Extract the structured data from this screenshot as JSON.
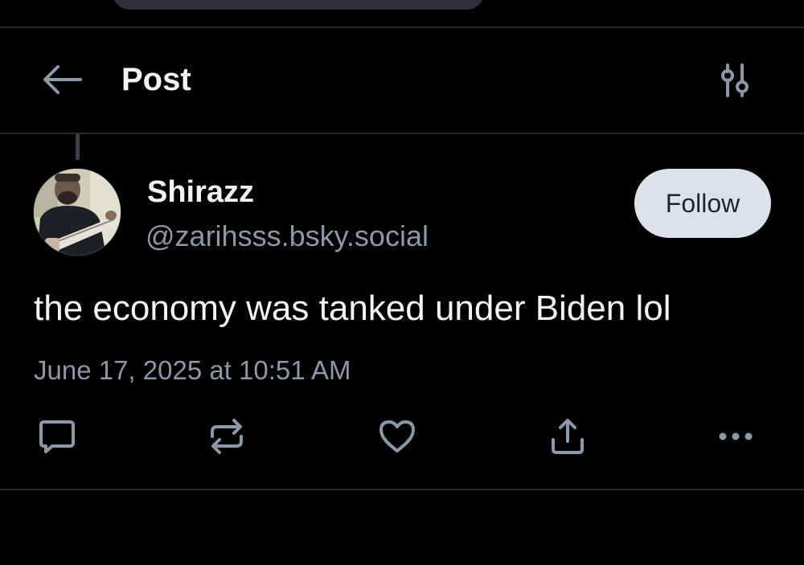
{
  "header": {
    "title": "Post"
  },
  "post": {
    "author": {
      "display_name": "Shirazz",
      "handle": "@zarihsss.bsky.social"
    },
    "follow_label": "Follow",
    "text": "the economy was tanked under Biden lol",
    "timestamp": "June 17, 2025 at 10:51 AM"
  },
  "icons": {
    "back": "arrow-left-icon",
    "filter": "sliders-icon",
    "reply": "reply-bubble-icon",
    "repost": "repost-icon",
    "like": "heart-icon",
    "share": "share-icon",
    "more": "more-dots-icon"
  },
  "colors": {
    "background": "#000000",
    "text_primary": "#f1f3f5",
    "text_secondary": "#8b98a9",
    "divider": "#262b31",
    "follow_button_bg": "#dce2ea",
    "icon": "#8b98a9"
  }
}
